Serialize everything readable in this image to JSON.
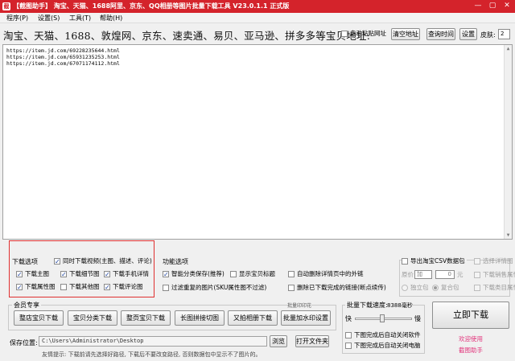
{
  "titlebar": {
    "app_icon": "截",
    "title": "【截图助手】 淘宝、天猫、1688阿里、京东、QQ相册等图片批量下载工具 V23.0.1.1 正式版",
    "min_icon": "—",
    "max_icon": "▢",
    "close_icon": "✕"
  },
  "menu": {
    "program": "程序(P)",
    "settings": "设置(S)",
    "tools": "工具(T)",
    "help": "帮助(H)"
  },
  "header": {
    "sites_label": "淘宝、天猫、1688、敦煌网、京东、速卖通、易贝、亚马逊、拼多多等宝贝地址:",
    "auto_paste": "自动粘贴网址",
    "clear_button": "清空地址",
    "query_time_button": "查询时间",
    "settings_button": "设置",
    "skin_label": "皮肤:",
    "skin_value": "2"
  },
  "urls": [
    "https://item.jd.com/69228235644.html",
    "https://item.jd.com/65931235253.html",
    "https://item.jd.com/67071174112.html"
  ],
  "download_options": {
    "title": "下载选项",
    "video": "同时下载视频(主图、描述、评论)",
    "main_image": "下载主图",
    "detail_image": "下载细节图",
    "mobile_detail": "下载手机详情",
    "attribute_image": "下载属性图",
    "other_image": "下载其他图",
    "review_image": "下载评论图"
  },
  "function_options": {
    "title": "功能选项",
    "smart_classify": "智能分类保存(推荐)",
    "show_title": "显示宝贝标题",
    "auto_delete_external": "自动删除详情页中的外链",
    "filter_duplicate": "过滤重复的图片(SKU属性图不过滤)",
    "delete_completed": "删除已下载完成的链接(断点续传)"
  },
  "csv_options": {
    "export_csv": "导出淘宝CSV数据包",
    "select_detail": "选择详情图",
    "price_label": "原价",
    "price_op": "加",
    "price_value": "0",
    "price_unit": "元",
    "download_sales_attr": "下载销售属性",
    "independent_pack": "独立包",
    "merged_pack": "复合包",
    "download_category_attr": "下载类目属性"
  },
  "member": {
    "title": "会员专享",
    "whole_store": "整店宝贝下载",
    "category": "宝贝分类下载",
    "whole_page": "整页宝贝下载",
    "stitch": "长图拼接切图",
    "album": "又拍相册下载",
    "watermark": "批量加水印设置",
    "watermark_tag": "批量印印花"
  },
  "speed": {
    "title": "批量下载速度:",
    "value": "8388毫秒",
    "fast": "快",
    "slow": "慢",
    "level": 0.48,
    "close_software": "下图完成后自动关闭软件",
    "close_computer": "下图完成后自动关闭电脑"
  },
  "download_now": "立即下载",
  "welcome": "欢迎使用",
  "brand": "截图助手",
  "save": {
    "label": "保存位置:",
    "path": "C:\\Users\\Administrator\\Desktop",
    "browse": "浏览",
    "open_folder": "打开文件夹"
  },
  "tip": "友情提示: 下载前请先选择好路径, 下载后不要改变路径, 否则数据包中显示不了图片的。"
}
